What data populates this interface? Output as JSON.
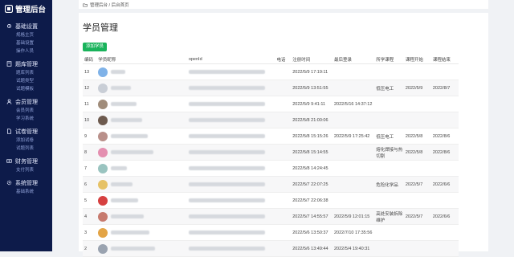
{
  "app": {
    "title": "管理后台"
  },
  "sidebar": {
    "groups": [
      {
        "icon": "settings-icon",
        "title": "基础设置",
        "items": [
          "规格主页",
          "基础设置",
          "操作人员"
        ]
      },
      {
        "icon": "book-icon",
        "title": "题库管理",
        "items": [
          "题库列表",
          "试题类型",
          "试题模板"
        ]
      },
      {
        "icon": "user-icon",
        "title": "会员管理",
        "items": [
          "会员列表",
          "学习系统"
        ]
      },
      {
        "icon": "paper-icon",
        "title": "试卷管理",
        "items": [
          "添加试卷",
          "试题列表"
        ]
      },
      {
        "icon": "money-icon",
        "title": "财务管理",
        "items": [
          "支付列表"
        ]
      },
      {
        "icon": "gear-icon",
        "title": "系统管理",
        "items": [
          "基础系统"
        ]
      }
    ]
  },
  "breadcrumb": {
    "text": "管理后台 / 后台首页"
  },
  "main": {
    "title": "学员管理",
    "add_button": "添加学员",
    "columns": [
      "编码",
      "学员昵称",
      "openId",
      "电话",
      "注册时间",
      "最后登录",
      "所学课程",
      "课程开始",
      "课程结束"
    ],
    "rows": [
      {
        "id": "13",
        "reg": "2022/5/9 17:19:11",
        "last": "",
        "course": "",
        "start": "",
        "end": ""
      },
      {
        "id": "12",
        "reg": "2022/5/9 13:51:55",
        "last": "",
        "course": "低压电工",
        "start": "2022/5/9",
        "end": "2022/8/7"
      },
      {
        "id": "11",
        "reg": "2022/5/9 9:41:11",
        "last": "2022/5/16 14:37:12",
        "course": "",
        "start": "",
        "end": ""
      },
      {
        "id": "10",
        "reg": "2022/5/8 21:00:06",
        "last": "",
        "course": "",
        "start": "",
        "end": ""
      },
      {
        "id": "9",
        "reg": "2022/5/8 15:15:26",
        "last": "2022/5/9 17:25:42",
        "course": "低压电工",
        "start": "2022/5/8",
        "end": "2022/8/6"
      },
      {
        "id": "8",
        "reg": "2022/5/8 15:14:55",
        "last": "",
        "course": "熔化焊接与热切割",
        "start": "2022/5/8",
        "end": "2022/8/6"
      },
      {
        "id": "7",
        "reg": "2022/5/8 14:24:45",
        "last": "",
        "course": "",
        "start": "",
        "end": ""
      },
      {
        "id": "6",
        "reg": "2022/5/7 22:07:25",
        "last": "",
        "course": "危险化学品",
        "start": "2022/5/7",
        "end": "2022/6/6"
      },
      {
        "id": "5",
        "reg": "2022/5/7 22:06:38",
        "last": "",
        "course": "",
        "start": "",
        "end": ""
      },
      {
        "id": "4",
        "reg": "2022/5/7 14:55:57",
        "last": "2022/5/9 12:01:15",
        "course": "高处安装拆除维护",
        "start": "2022/5/7",
        "end": "2022/6/6"
      },
      {
        "id": "3",
        "reg": "2022/5/6 13:50:37",
        "last": "2022/7/10 17:35:56",
        "course": "",
        "start": "",
        "end": ""
      },
      {
        "id": "2",
        "reg": "2022/5/6 13:49:44",
        "last": "2022/5/4 19:40:31",
        "course": "",
        "start": "",
        "end": ""
      }
    ]
  },
  "colors": {
    "sidebar_bg": "#0d1b4a",
    "accent": "#19b35b",
    "active_link": "#4e7cff"
  }
}
